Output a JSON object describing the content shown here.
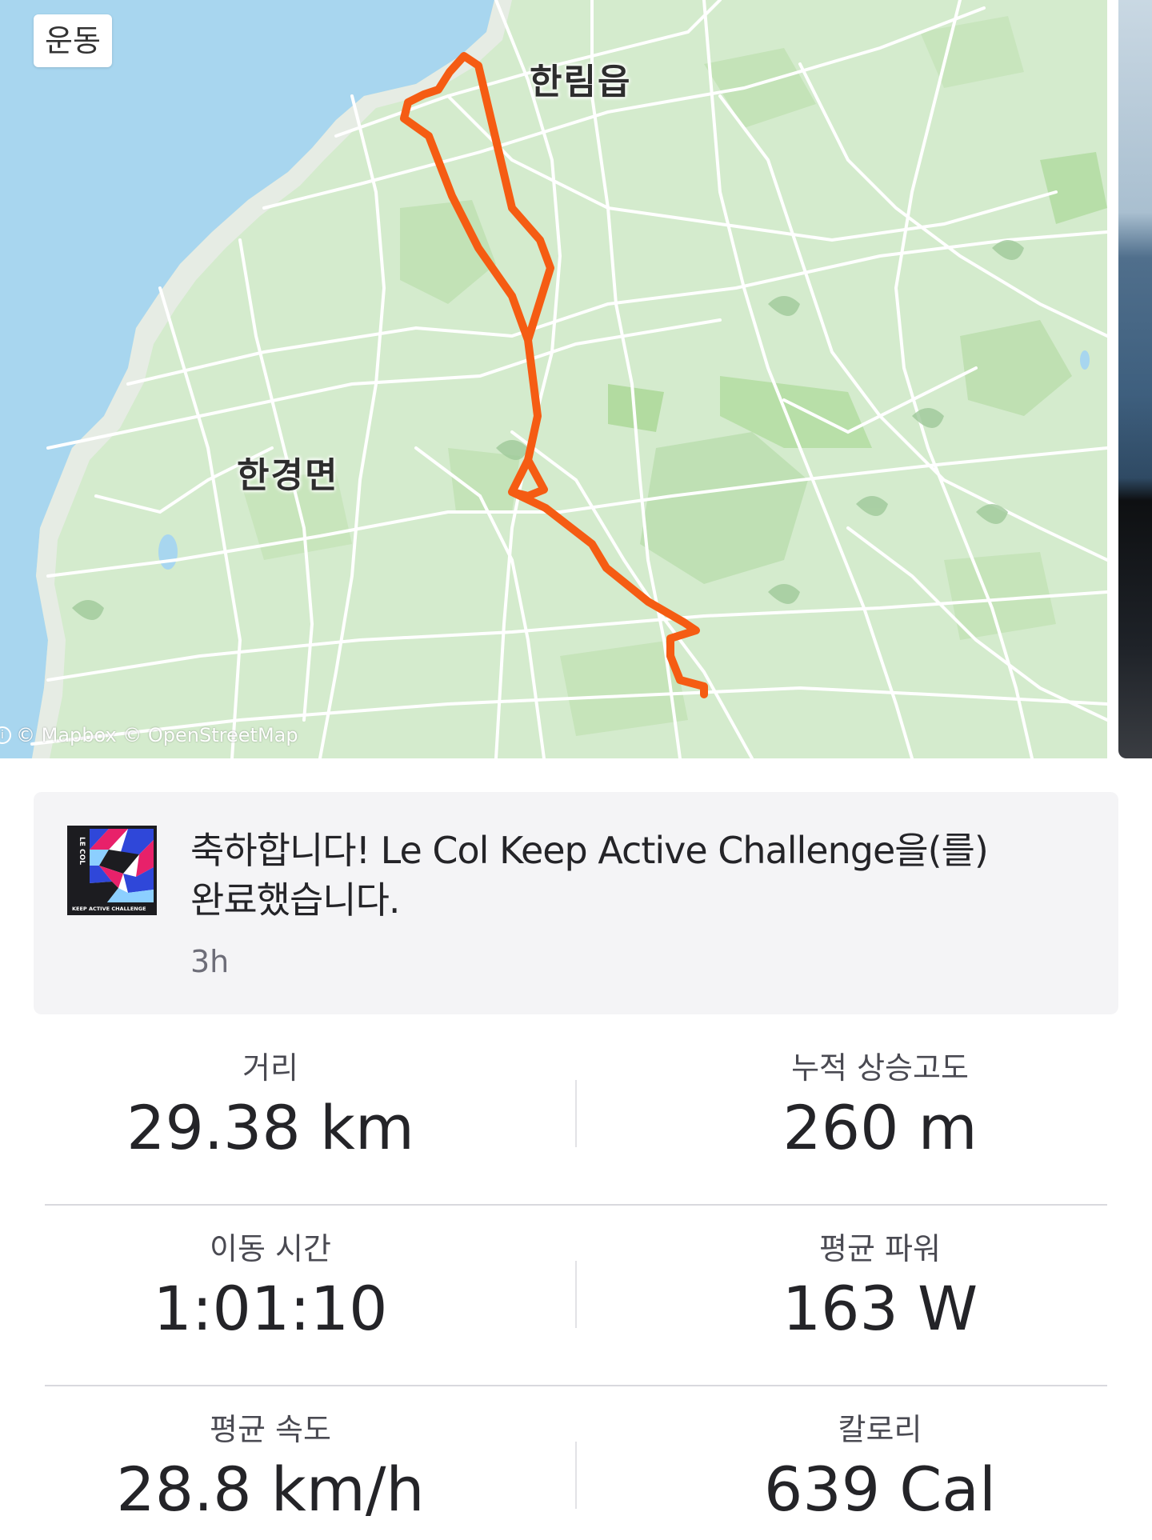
{
  "map": {
    "badge": "운동",
    "places": {
      "hallim": "한림읍",
      "hangyeong": "한경면"
    },
    "attribution": "© Mapbox © OpenStreetMap",
    "route_color": "#f55c13"
  },
  "challenge": {
    "logo_text": "LE COL",
    "logo_caption": "KEEP ACTIVE CHALLENGE",
    "message_line1": "축하합니다! Le Col Keep Active Challenge을(를)",
    "message_line2": "완료했습니다.",
    "time": "3h"
  },
  "stats": [
    {
      "label": "거리",
      "value": "29.38 km"
    },
    {
      "label": "누적 상승고도",
      "value": "260 m"
    },
    {
      "label": "이동 시간",
      "value": "1:01:10"
    },
    {
      "label": "평균 파워",
      "value": "163 W"
    },
    {
      "label": "평균 속도",
      "value": "28.8 km/h"
    },
    {
      "label": "칼로리",
      "value": "639 Cal"
    }
  ]
}
